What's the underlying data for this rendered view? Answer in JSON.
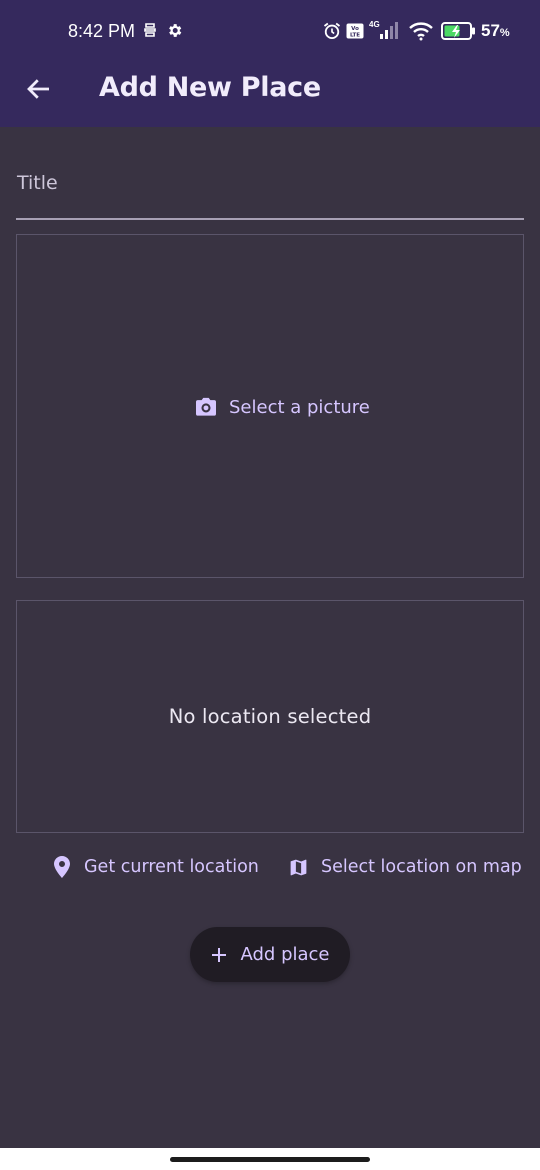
{
  "status_bar": {
    "time": "8:42 PM",
    "network": "4G",
    "battery_percent": "57",
    "battery_percent_unit": "%"
  },
  "app_bar": {
    "title": "Add New Place"
  },
  "form": {
    "title_label": "Title",
    "picture_button_label": "Select a picture",
    "location_placeholder": "No location selected",
    "get_current_location_label": "Get current location",
    "select_on_map_label": "Select location on map",
    "add_place_label": "Add place"
  },
  "colors": {
    "app_bar": "#35295d",
    "background": "#393342",
    "accent": "#d6c6ff",
    "button_bg": "#201c24"
  },
  "icons": [
    "back-arrow-icon",
    "camera-icon",
    "location-pin-icon",
    "map-icon",
    "plus-icon",
    "alarm-icon",
    "wifi-icon",
    "battery-icon",
    "settings-icon"
  ]
}
